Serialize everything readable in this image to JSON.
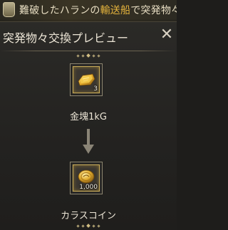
{
  "banner": {
    "text_pre": "難破したハランの",
    "text_highlight": "輸送船",
    "text_post": "で突発物々..."
  },
  "dialog": {
    "title": "突発物々交換プレビュー",
    "close_symbol": "✕"
  },
  "trade": {
    "give": {
      "name": "金塊1kG",
      "quantity": "3",
      "icon": "gold-bar-icon"
    },
    "receive": {
      "name": "カラスコイン",
      "quantity": "1,000",
      "icon": "crow-coin-icon"
    }
  },
  "colors": {
    "accent": "#e3b23c",
    "frame_gold": "#c9ab55",
    "text": "#ece5d6"
  }
}
